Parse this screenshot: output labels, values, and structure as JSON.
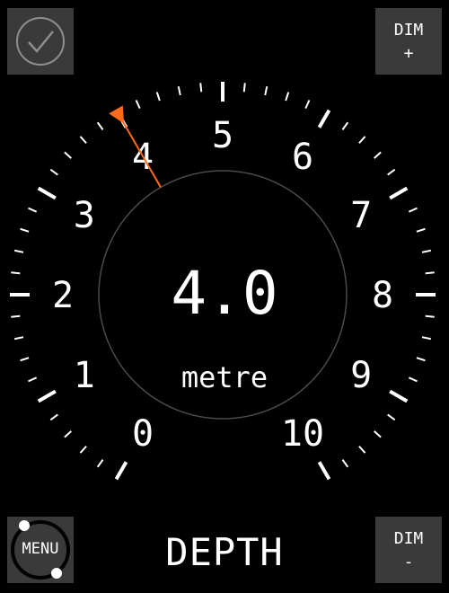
{
  "buttons": {
    "dim_up": {
      "line1": "DIM",
      "line2": "+"
    },
    "dim_down": {
      "line1": "DIM",
      "line2": "-"
    },
    "menu": "MENU"
  },
  "gauge": {
    "min": 0,
    "max": 10,
    "labels": [
      "0",
      "1",
      "2",
      "3",
      "4",
      "5",
      "6",
      "7",
      "8",
      "9",
      "10"
    ],
    "value": 4.0,
    "value_text": "4.0",
    "unit": "metre",
    "pointer_color": "#ff6a1a"
  },
  "title": "DEPTH",
  "colors": {
    "background": "#000000",
    "button_bg": "#3a3a3a",
    "pointer": "#ff6a1a"
  }
}
